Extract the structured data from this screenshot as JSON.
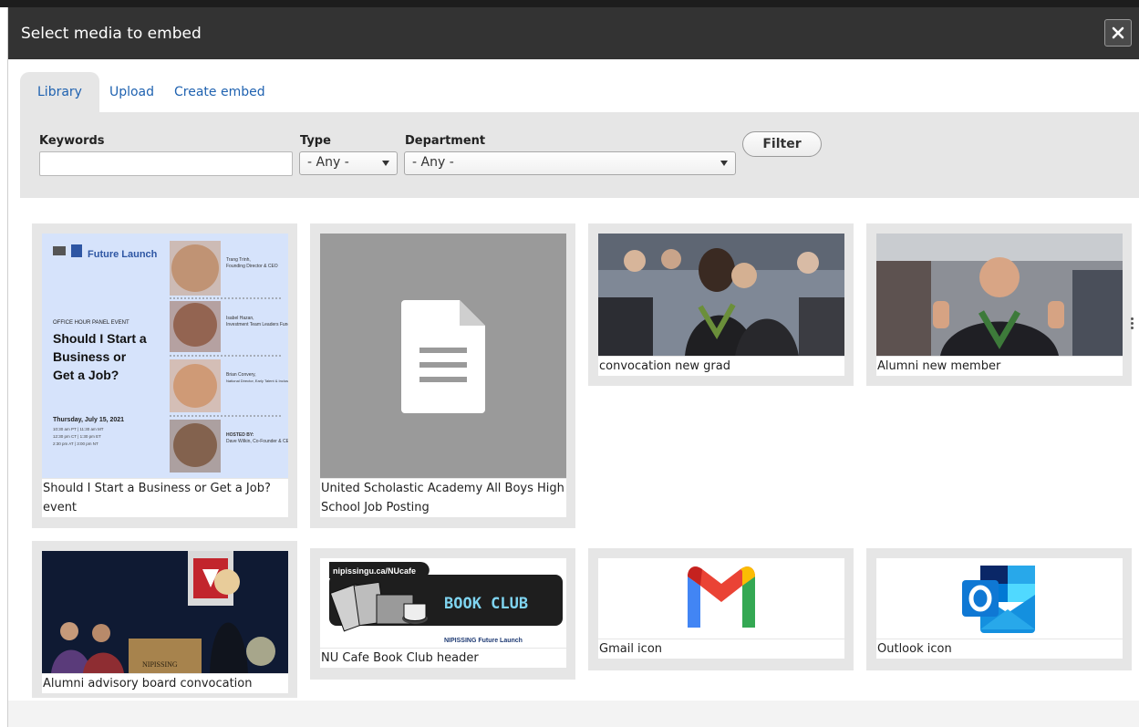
{
  "dialog": {
    "title": "Select media to embed",
    "close_icon": "close-icon"
  },
  "tabs": [
    {
      "label": "Library",
      "active": true
    },
    {
      "label": "Upload",
      "active": false
    },
    {
      "label": "Create embed",
      "active": false
    }
  ],
  "filters": {
    "keywords_label": "Keywords",
    "keywords_value": "",
    "type_label": "Type",
    "type_value": "- Any -",
    "department_label": "Department",
    "department_value": "- Any -",
    "filter_button": "Filter"
  },
  "media": [
    {
      "caption": "Should I Start a Business or Get a Job? event",
      "kind": "event-poster"
    },
    {
      "caption": "United Scholastic Academy All Boys High School Job Posting",
      "kind": "document-icon"
    },
    {
      "caption": "convocation new grad",
      "kind": "photo"
    },
    {
      "caption": "Alumni new member",
      "kind": "photo"
    },
    {
      "caption": "Alumni advisory board convocation",
      "kind": "photo"
    },
    {
      "caption": "NU Cafe Book Club header",
      "kind": "banner"
    },
    {
      "caption": "Gmail icon",
      "kind": "gmail-logo"
    },
    {
      "caption": "Outlook icon",
      "kind": "outlook-logo"
    }
  ],
  "poster": {
    "brand": "Future Launch",
    "kicker": "OFFICE HOUR PANEL EVENT",
    "headline": "Should I Start a Business or Get a Job?",
    "date": "Thursday, July 15, 2021",
    "times": "10:30 am PT | 11:30 am MT 12:30 pm CT | 1:30 pm ET 2:30 pm AT | 3:00 pm NT",
    "speakers": [
      {
        "name": "Trang Trinh,",
        "role": "Founding Director & CEO"
      },
      {
        "name": "Isabel Hazan,",
        "role": "Investment Team Leaders Fund"
      },
      {
        "name": "Brian Convery,",
        "role": "National Director, Early Talent & Inclusive Recruitment"
      },
      {
        "name": "HOSTED BY:",
        "role": "Dave Wilkin, Co-Founder & CEO"
      }
    ]
  },
  "bookclub": {
    "url": "nipissingu.ca/NUcafe",
    "title": "BOOK CLUB",
    "footer": "NIPISSING   Future Launch"
  },
  "podium_text": "NIPISSING"
}
